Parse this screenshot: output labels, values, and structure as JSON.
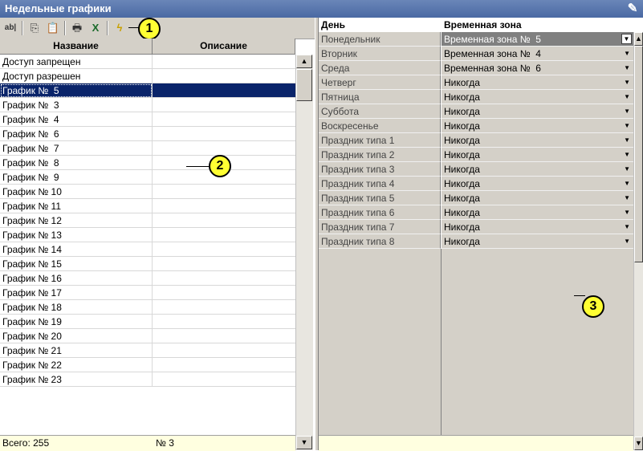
{
  "window": {
    "title": "Недельные графики",
    "title_icon": "pin-icon"
  },
  "toolbar": {
    "buttons": [
      {
        "icon": "rename-icon",
        "glyph": "ab|"
      },
      {
        "icon": "copy-icon",
        "glyph": "⎘"
      },
      {
        "icon": "paste-icon",
        "glyph": "📋"
      },
      {
        "icon": "print-icon",
        "glyph": "🖶"
      },
      {
        "icon": "excel-export-icon",
        "glyph": "X"
      },
      {
        "icon": "lightning-icon",
        "glyph": "ϟ"
      }
    ]
  },
  "callouts": {
    "one": "1",
    "two": "2",
    "three": "3"
  },
  "schedules": {
    "columns": {
      "name": "Название",
      "description": "Описание"
    },
    "rows": [
      "Доступ запрещен",
      "Доступ разрешен",
      "График №  5",
      "График №  3",
      "График №  4",
      "График №  6",
      "График №  7",
      "График №  8",
      "График №  9",
      "График № 10",
      "График № 11",
      "График № 12",
      "График № 13",
      "График № 14",
      "График № 15",
      "График № 16",
      "График № 17",
      "График № 18",
      "График № 19",
      "График № 20",
      "График № 21",
      "График № 22",
      "График № 23"
    ],
    "selected_index": 2,
    "footer": {
      "total": "Всего: 255",
      "current": "№ 3"
    }
  },
  "week": {
    "columns": {
      "day": "День",
      "zone": "Временная зона"
    },
    "rows": [
      {
        "day": "Понедельник",
        "zone": "Временная зона №  5"
      },
      {
        "day": "Вторник",
        "zone": "Временная зона №  4"
      },
      {
        "day": "Среда",
        "zone": "Временная зона №  6"
      },
      {
        "day": "Четверг",
        "zone": "Никогда"
      },
      {
        "day": "Пятница",
        "zone": "Никогда"
      },
      {
        "day": "Суббота",
        "zone": "Никогда"
      },
      {
        "day": "Воскресенье",
        "zone": "Никогда"
      },
      {
        "day": "Праздник типа 1",
        "zone": "Никогда"
      },
      {
        "day": "Праздник типа 2",
        "zone": "Никогда"
      },
      {
        "day": "Праздник типа 3",
        "zone": "Никогда"
      },
      {
        "day": "Праздник типа 4",
        "zone": "Никогда"
      },
      {
        "day": "Праздник типа 5",
        "zone": "Никогда"
      },
      {
        "day": "Праздник типа 6",
        "zone": "Никогда"
      },
      {
        "day": "Праздник типа 7",
        "zone": "Никогда"
      },
      {
        "day": "Праздник типа 8",
        "zone": "Никогда"
      }
    ],
    "selected_index": 0
  },
  "colors": {
    "title_bar": "#4a69a3",
    "selection": "#0a246a",
    "callout": "#ffff33",
    "footer": "#ffffe0"
  }
}
